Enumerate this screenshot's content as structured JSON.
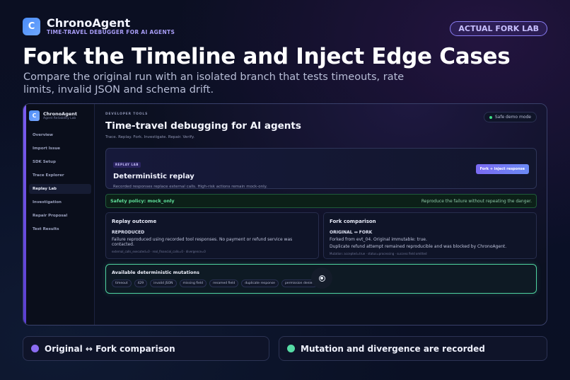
{
  "brand": {
    "logo_letter": "C",
    "name": "ChronoAgent",
    "tagline": "TIME-TRAVEL DEBUGGER FOR AI AGENTS"
  },
  "top_badge": "ACTUAL FORK LAB",
  "hero": {
    "title": "Fork the Timeline and Inject Edge Cases",
    "subtitle": "Compare the original run with an isolated branch that tests timeouts, rate limits, invalid JSON and schema drift."
  },
  "app": {
    "sidebar": {
      "logo_letter": "C",
      "name": "ChronoAgent",
      "sub": "Agent Reliability Lab",
      "items": [
        {
          "label": "Overview"
        },
        {
          "label": "Import Issue"
        },
        {
          "label": "SDK Setup"
        },
        {
          "label": "Trace Explorer"
        },
        {
          "label": "Replay Lab",
          "active": true
        },
        {
          "label": "Investigation"
        },
        {
          "label": "Repair Proposal"
        },
        {
          "label": "Test Results"
        }
      ]
    },
    "header": {
      "eyebrow": "DEVELOPER TOOLS",
      "title": "Time-travel debugging for AI agents",
      "subtitle": "Trace. Replay. Fork. Investigate. Repair. Verify.",
      "safe_mode": "Safe demo mode"
    },
    "replay": {
      "chip": "REPLAY LAB",
      "title": "Deterministic replay",
      "description": "Recorded responses replace external calls. High-risk actions remain mock-only.",
      "button": "Fork + inject response"
    },
    "policy": {
      "left": "Safety policy: mock_only",
      "right": "Reproduce the failure without repeating the danger."
    },
    "outcome": {
      "title": "Replay outcome",
      "status": "REPRODUCED",
      "line": "Failure reproduced using recorded tool responses. No payment or refund service was contacted.",
      "meta": "external_calls_executed=0 · real_financial_calls=0 · divergence=0"
    },
    "fork": {
      "title": "Fork comparison",
      "status": "ORIGINAL ↔ FORK",
      "line1": "Forked from evt_04. Original immutable: true.",
      "line2": "Duplicate refund attempt remained reproducible and was blocked by ChronoAgent.",
      "meta": "Mutation: accepted=true · status=processing · success field omitted"
    },
    "mutations": {
      "title": "Available deterministic mutations",
      "tags": [
        "timeout",
        "429",
        "invalid JSON",
        "missing field",
        "renamed field",
        "duplicate response",
        "permission denied"
      ]
    }
  },
  "features": [
    {
      "label": "Original ↔ Fork comparison",
      "color": "#8b6cf2"
    },
    {
      "label": "Mutation and divergence are recorded",
      "color": "#56dca5"
    }
  ]
}
